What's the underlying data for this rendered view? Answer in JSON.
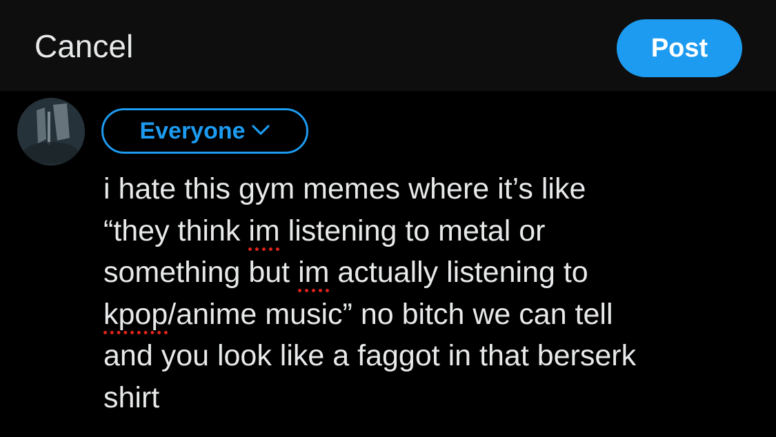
{
  "header": {
    "cancel_label": "Cancel",
    "post_label": "Post"
  },
  "composer": {
    "audience_label": "Everyone",
    "lines": [
      [
        {
          "t": "i hate this gym memes where it’s like",
          "s": false
        }
      ],
      [
        {
          "t": "“they think ",
          "s": false
        },
        {
          "t": "im",
          "s": true
        },
        {
          "t": " listening to metal or",
          "s": false
        }
      ],
      [
        {
          "t": "something but ",
          "s": false
        },
        {
          "t": "im",
          "s": true
        },
        {
          "t": " actually listening to",
          "s": false
        }
      ],
      [
        {
          "t": "kpop",
          "s": true
        },
        {
          "t": "/anime music” no bitch we can tell",
          "s": false
        }
      ],
      [
        {
          "t": "and you look like a faggot in that berserk",
          "s": false
        }
      ],
      [
        {
          "t": "shirt",
          "s": false
        }
      ]
    ]
  },
  "colors": {
    "accent": "#1d9bf0",
    "background": "#000000",
    "header_background": "#0e0e0e",
    "text": "#e7e9ea",
    "spellcheck": "#e0241b"
  },
  "icons": {
    "audience_chevron": "chevron-down-icon"
  }
}
